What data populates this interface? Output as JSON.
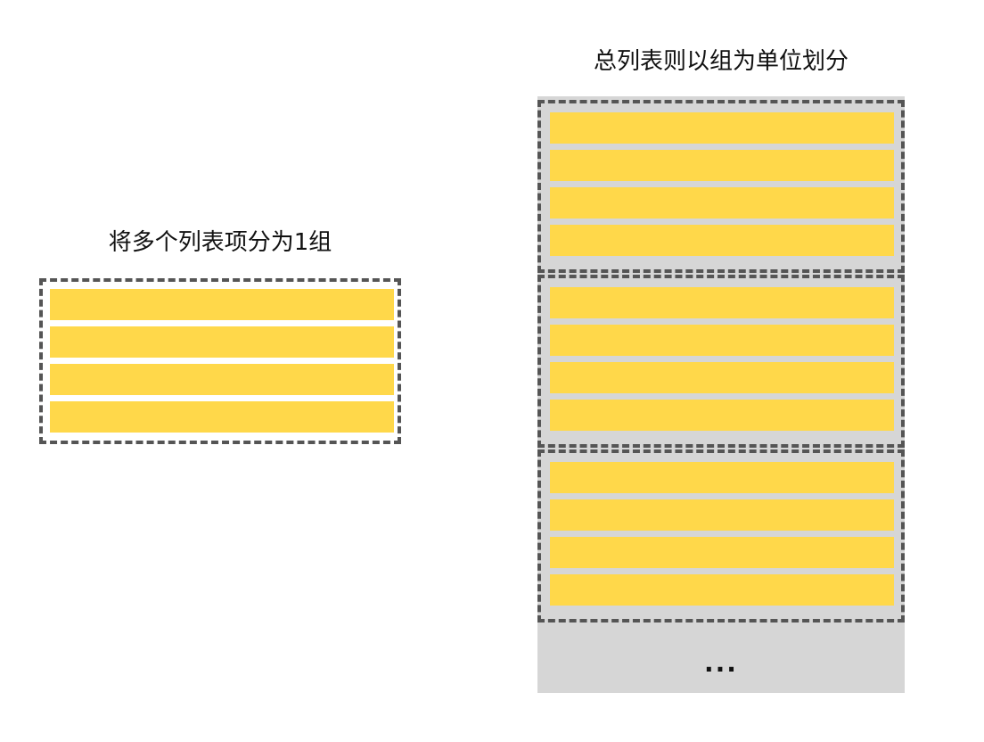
{
  "left": {
    "caption": "将多个列表项分为1组",
    "group": {
      "item_count": 4
    }
  },
  "right": {
    "caption": "总列表则以组为单位划分",
    "group_count": 3,
    "items_per_group": 4,
    "ellipsis": "..."
  },
  "colors": {
    "item": "#FFD84A",
    "list_background": "#D6D6D6",
    "group_border": "#555555"
  }
}
